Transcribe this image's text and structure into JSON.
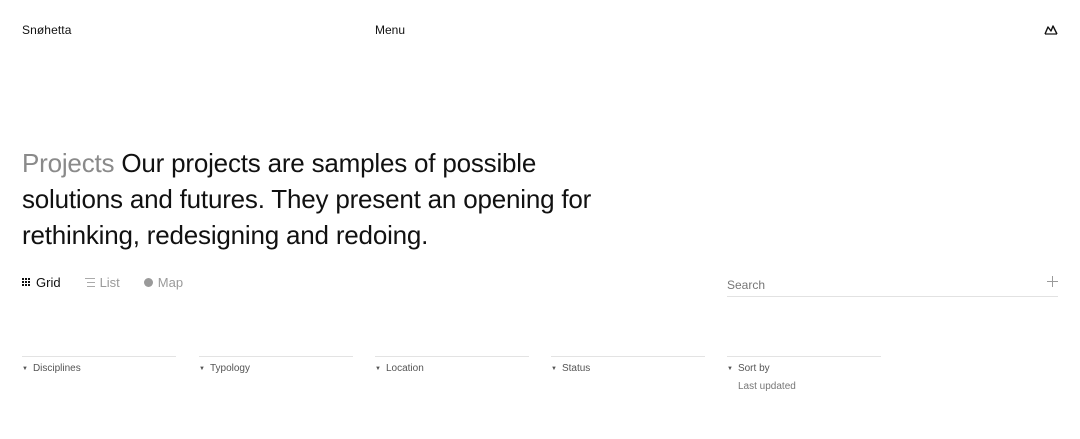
{
  "header": {
    "logo": "Snøhetta",
    "menu_label": "Menu",
    "lang_icon": "language-icon"
  },
  "intro": {
    "label": "Projects",
    "text": "Our projects are samples of possible solutions and futures. They present an opening for rethinking, redesigning and redoing."
  },
  "views": [
    {
      "label": "Grid",
      "icon": "grid-icon",
      "active": true
    },
    {
      "label": "List",
      "icon": "list-icon",
      "active": false
    },
    {
      "label": "Map",
      "icon": "map-dot-icon",
      "active": false
    }
  ],
  "search": {
    "placeholder": "Search",
    "add_icon": "plus-icon"
  },
  "filters": [
    {
      "label": "Disciplines",
      "icon": "triangle-down-icon"
    },
    {
      "label": "Typology",
      "icon": "triangle-down-icon"
    },
    {
      "label": "Location",
      "icon": "triangle-down-icon"
    },
    {
      "label": "Status",
      "icon": "triangle-down-icon"
    },
    {
      "label": "Sort by",
      "value": "Last updated",
      "icon": "triangle-down-icon"
    }
  ],
  "colors": {
    "text": "#111111",
    "muted": "#8a8a8a",
    "divider": "#e3e3e3"
  }
}
